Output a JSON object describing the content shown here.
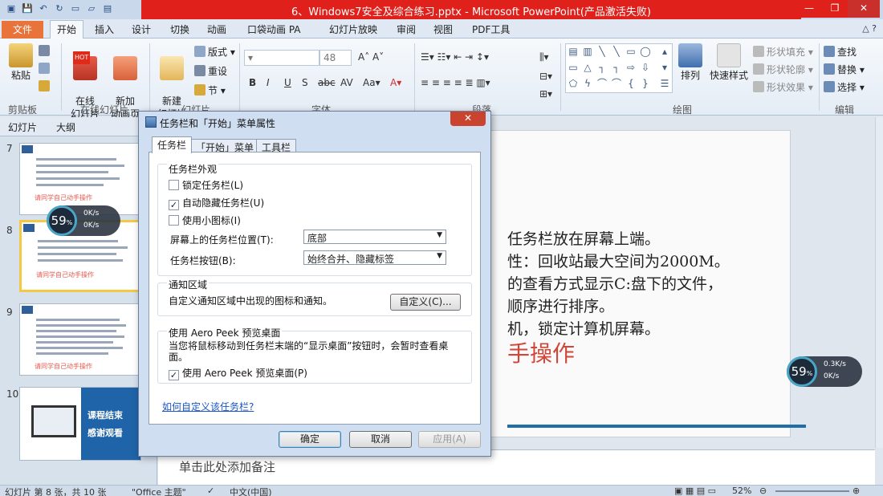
{
  "window": {
    "title": "6、Windows7安全及综合练习.pptx - Microsoft PowerPoint(产品激活失败)",
    "minimize": "—",
    "maximize": "❐",
    "close": "✕"
  },
  "ribbon": {
    "tabs": [
      "文件",
      "开始",
      "插入",
      "设计",
      "切换",
      "动画",
      "口袋动画 PA",
      "幻灯片放映",
      "审阅",
      "视图",
      "PDF工具"
    ],
    "active_tab": "开始",
    "groups": {
      "clipboard": {
        "label": "剪贴板",
        "paste": "粘贴"
      },
      "online_slides": {
        "label": "在线幻灯片",
        "btn1": "在线\n幻灯片",
        "btn2": "新加\n动画页",
        "hot": "HOT"
      },
      "slides": {
        "label": "幻灯片",
        "new_slide": "新建\n幻灯片",
        "layout": "版式",
        "reset": "重设",
        "section": "节"
      },
      "font": {
        "label": "字体",
        "size": "48"
      },
      "paragraph": {
        "label": "段落"
      },
      "drawing": {
        "label": "绘图",
        "arrange": "排列",
        "quick_styles": "快速样式",
        "fill": "形状填充",
        "outline": "形状轮廓",
        "effects": "形状效果"
      },
      "editing": {
        "label": "编辑",
        "find": "查找",
        "replace": "替换",
        "select": "选择"
      }
    }
  },
  "left_panel": {
    "tabs": [
      "幻灯片",
      "大纲"
    ],
    "slides": [
      {
        "num": "7",
        "red": "请同学自己动手操作"
      },
      {
        "num": "8",
        "red": "请同学自己动手操作"
      },
      {
        "num": "9",
        "red": "请同学自己动手操作"
      },
      {
        "num": "10",
        "title1": "课程结束",
        "title2": "感谢观看"
      }
    ]
  },
  "slide": {
    "lines": [
      "任务栏放在屏幕上端。",
      "性：回收站最大空间为2000M。",
      "的查看方式显示C:盘下的文件，",
      "顺序进行排序。",
      "机，锁定计算机屏幕。"
    ],
    "red_text": "手操作"
  },
  "notes": {
    "placeholder": "单击此处添加备注"
  },
  "status": {
    "slide_info": "幻灯片 第 8 张，共 10 张",
    "theme": "\"Office 主题\"",
    "lang": "中文(中国)",
    "zoom": "52%"
  },
  "speed_widgets": [
    {
      "percent": "59",
      "up": "0K/s",
      "down": "0K/s"
    },
    {
      "percent": "59",
      "up": "0.3K/s",
      "down": "0K/s"
    }
  ],
  "dialog": {
    "title": "任务栏和「开始」菜单属性",
    "close": "✕",
    "tabs": [
      "任务栏",
      "「开始」菜单",
      "工具栏"
    ],
    "appearance": {
      "title": "任务栏外观",
      "lock": "锁定任务栏(L)",
      "autohide": "自动隐藏任务栏(U)",
      "small_icons": "使用小图标(I)",
      "position_label": "屏幕上的任务栏位置(T):",
      "position_value": "底部",
      "buttons_label": "任务栏按钮(B):",
      "buttons_value": "始终合并、隐藏标签"
    },
    "notification": {
      "title": "通知区域",
      "desc": "自定义通知区域中出现的图标和通知。",
      "customize": "自定义(C)..."
    },
    "aero": {
      "title": "使用 Aero Peek 预览桌面",
      "desc": "当您将鼠标移动到任务栏末端的“显示桌面”按钮时，会暂时查看桌面。",
      "checkbox": "使用 Aero Peek 预览桌面(P)"
    },
    "link": "如何自定义该任务栏?",
    "ok": "确定",
    "cancel": "取消",
    "apply": "应用(A)"
  },
  "colors": {
    "accent": "#e0201a",
    "file_tab": "#e8743b",
    "slide_red": "#d2463a",
    "bar_blue": "#1f6ea7"
  }
}
